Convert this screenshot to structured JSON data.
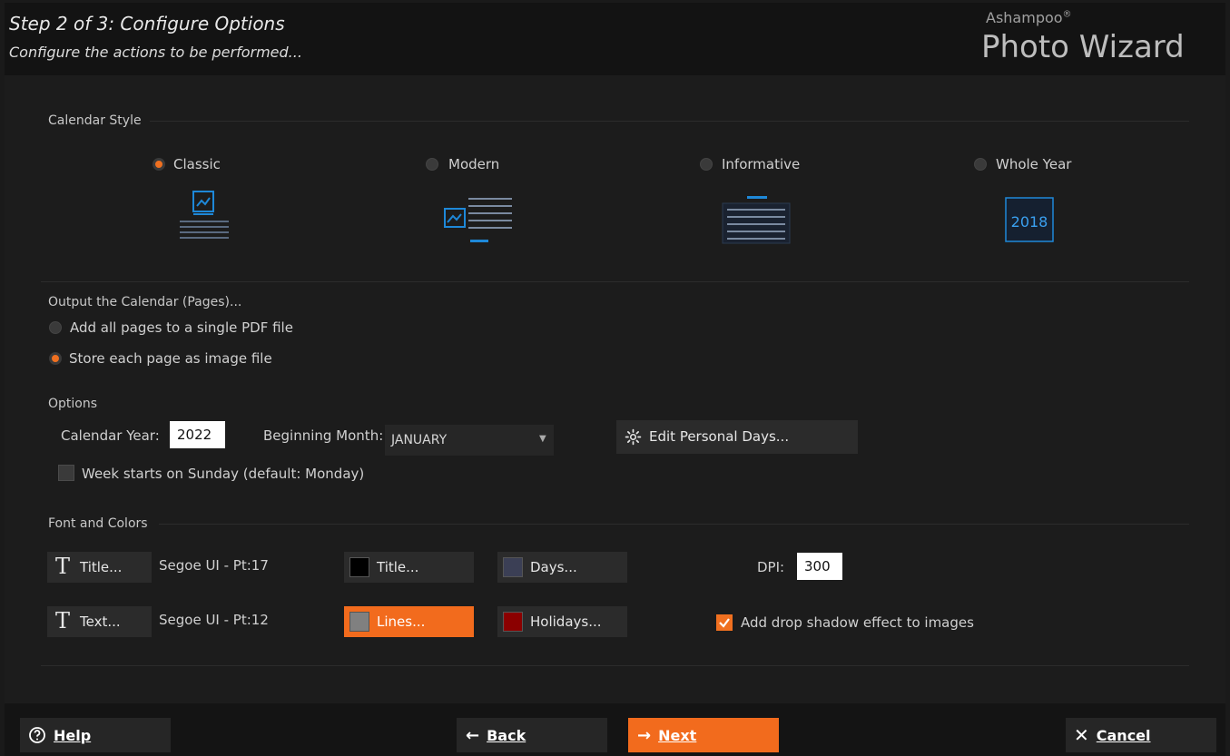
{
  "header": {
    "title": "Step 2 of 3: Configure Options",
    "subtitle": "Configure the actions to be performed...",
    "brand_small": "Ashampoo",
    "brand_mark": "®",
    "brand_big": "Photo Wizard"
  },
  "calendar_style": {
    "label": "Calendar Style",
    "options": [
      {
        "label": "Classic",
        "selected": true
      },
      {
        "label": "Modern",
        "selected": false
      },
      {
        "label": "Informative",
        "selected": false
      },
      {
        "label": "Whole Year",
        "selected": false
      }
    ],
    "whole_year_thumb_text": "2018"
  },
  "output": {
    "label": "Output the Calendar (Pages)...",
    "options": [
      {
        "label": "Add all pages to a single PDF file",
        "selected": false
      },
      {
        "label": "Store each page as image file",
        "selected": true
      }
    ]
  },
  "options": {
    "label": "Options",
    "year_label": "Calendar Year:",
    "year_value": "2022",
    "month_label": "Beginning Month:",
    "month_value": "JANUARY",
    "edit_days_label": "Edit Personal Days...",
    "week_sunday_label": "Week starts on Sunday (default: Monday)",
    "week_sunday_checked": false
  },
  "fonts": {
    "label": "Font and Colors",
    "title_font_button": "Title...",
    "title_font_value": "Segoe UI - Pt:17",
    "text_font_button": "Text...",
    "text_font_value": "Segoe UI - Pt:12",
    "title_color_button": "Title...",
    "days_color_button": "Days...",
    "lines_color_button": "Lines...",
    "holidays_color_button": "Holidays...",
    "dpi_label": "DPI:",
    "dpi_value": "300",
    "shadow_label": "Add drop shadow effect to images",
    "shadow_checked": true
  },
  "colors": {
    "accent": "#f26b1d",
    "title_swatch": "#000000",
    "days_swatch": "#3b3f55",
    "lines_swatch": "#808080",
    "holidays_swatch": "#8b0000"
  },
  "footer": {
    "help": "Help",
    "back": "Back",
    "next": "Next",
    "cancel": "Cancel"
  }
}
